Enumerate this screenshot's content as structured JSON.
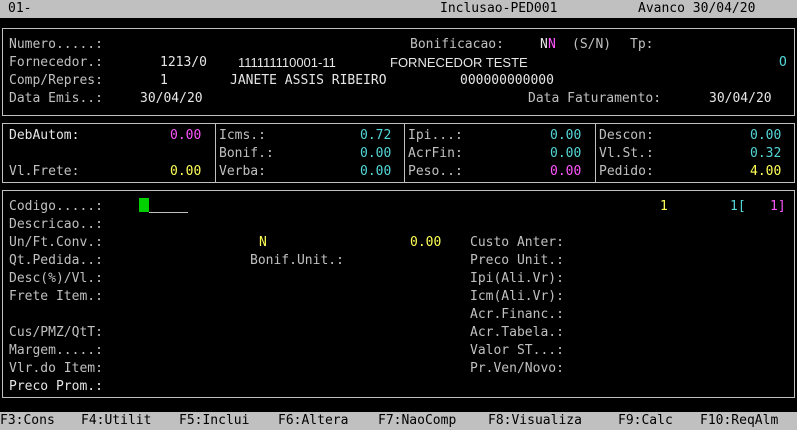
{
  "title_bar": {
    "screen_code": "01-",
    "program": "Inclusao-PED001",
    "mode_date": "Avanco 30/04/20"
  },
  "header": {
    "numero_label": "Numero.....:",
    "bonificacao_label": "Bonificacao:",
    "bonificacao_value_1": "N",
    "bonificacao_value_2": "N",
    "bonificacao_hint": "(S/N)",
    "tp_label": "Tp:",
    "fornecedor_label": "Fornecedor.:",
    "fornecedor_code": "1213/0",
    "fornecedor_cnpj": "111111110001-11",
    "fornecedor_name": "FORNECEDOR TESTE",
    "fornecedor_flag": "O",
    "comprep_label": "Comp/Repres:",
    "comprep_code": "1",
    "comprep_name": "JANETE ASSIS RIBEIRO",
    "comprep_number": "000000000000",
    "data_emis_label": "Data Emis..:",
    "data_emis_value": "30/04/20",
    "data_fat_label": "Data Faturamento:",
    "data_fat_value": "30/04/20"
  },
  "totals": {
    "debautom_label": "DebAutom:",
    "debautom_value": "0.00",
    "vlfrete_label": "Vl.Frete:",
    "vlfrete_value": "0.00",
    "icms_label": "Icms.:",
    "icms_value": "0.72",
    "bonif_label": "Bonif.:",
    "bonif_value": "0.00",
    "verba_label": "Verba:",
    "verba_value": "0.00",
    "ipi_label": "Ipi...:",
    "ipi_value": "0.00",
    "acrfin_label": "AcrFin:",
    "acrfin_value": "0.00",
    "peso_label": "Peso..:",
    "peso_value": "0.00",
    "descon_label": "Descon:",
    "descon_value": "0.00",
    "vlst_label": "Vl.St.:",
    "vlst_value": "0.32",
    "pedido_label": "Pedido:",
    "pedido_value": "4.00"
  },
  "item": {
    "codigo_label": "Codigo.....:",
    "counter_1": "1",
    "counter_2": "1[",
    "counter_3": "1]",
    "descricao_label": "Descricao..:",
    "unft_label": "Un/Ft.Conv.:",
    "unft_flag": "N",
    "unft_value": "0.00",
    "custo_anter_label": "Custo Anter:",
    "qtpedida_label": "Qt.Pedida..:",
    "bonif_unit_label": "Bonif.Unit.:",
    "preco_unit_label": "Preco Unit.:",
    "desc_label": "Desc(%)/Vl.:",
    "ipi_ali_label": "Ipi(Ali.Vr):",
    "frete_item_label": "Frete Item.:",
    "icm_ali_label": "Icm(Ali.Vr):",
    "acr_financ_label": "Acr.Financ.:",
    "cus_pmz_label": "Cus/PMZ/QtT:",
    "acr_tabela_label": "Acr.Tabela.:",
    "margem_label": "Margem.....:",
    "valor_st_label": "Valor ST...:",
    "vlr_item_label": "Vlr.do Item:",
    "pr_ven_label": "Pr.Ven/Novo:",
    "preco_prom_label": "Preco Prom.:"
  },
  "function_keys": [
    "F3:Cons",
    "F4:Utilit",
    "F5:Inclui",
    "F6:Altera",
    "F7:NaoComp",
    "F8:Visualiza",
    "F9:Calc",
    "F10:ReqAlm"
  ],
  "colors": {
    "background": "#000000",
    "label": "#c0c0c0",
    "value_white": "#e6e6e6",
    "cyan": "#54d7d7",
    "yellow": "#ffff55",
    "magenta": "#ff55ff",
    "cursor": "#00d000",
    "bar": "#c0c0c0"
  }
}
